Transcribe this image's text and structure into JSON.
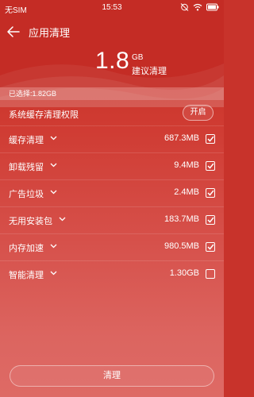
{
  "status_bar": {
    "carrier": "无SIM",
    "time": "15:53",
    "icons": [
      "alarm-off-icon",
      "wifi-icon",
      "battery-icon"
    ]
  },
  "header": {
    "title": "应用清理",
    "back_icon": "arrow-left-icon",
    "total_size": "1.8",
    "total_unit": "GB",
    "total_caption": "建议清理"
  },
  "selected": {
    "text": "已选择:1.82GB"
  },
  "permission": {
    "label": "系统缓存清理权限",
    "button_label": "开启"
  },
  "items": [
    {
      "label": "缓存清理",
      "size": "687.3MB",
      "checked": true
    },
    {
      "label": "卸载残留",
      "size": "9.4MB",
      "checked": true
    },
    {
      "label": "广告垃圾",
      "size": "2.4MB",
      "checked": true
    },
    {
      "label": "无用安装包",
      "size": "183.7MB",
      "checked": true
    },
    {
      "label": "内存加速",
      "size": "980.5MB",
      "checked": true
    },
    {
      "label": "智能清理",
      "size": "1.30GB",
      "checked": false
    }
  ],
  "footer": {
    "clean_label": "清理"
  },
  "colors": {
    "background": "#c8332b",
    "text": "#ffffff"
  }
}
